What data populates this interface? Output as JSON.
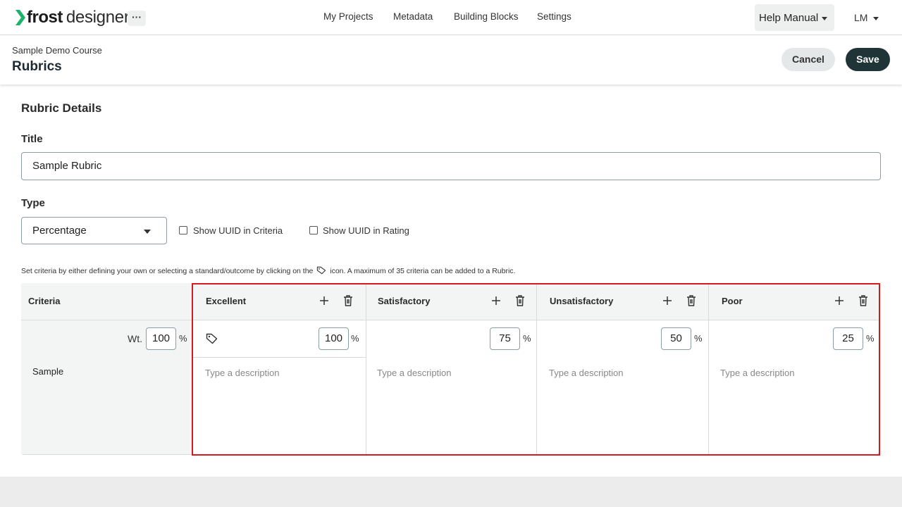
{
  "app": {
    "logo_bold": "frost",
    "logo_light": "designer",
    "more_label": "···"
  },
  "nav": {
    "links": [
      "My Projects",
      "Metadata",
      "Building Blocks",
      "Settings"
    ],
    "help_label": "Help Manual",
    "user_initials": "LM"
  },
  "header": {
    "breadcrumb": "Sample Demo Course",
    "title": "Rubrics",
    "cancel_label": "Cancel",
    "save_label": "Save"
  },
  "form": {
    "section_title": "Rubric Details",
    "title_label": "Title",
    "title_value": "Sample Rubric",
    "type_label": "Type",
    "type_value": "Percentage",
    "show_uuid_criteria_label": "Show UUID in Criteria",
    "show_uuid_criteria_checked": false,
    "show_uuid_rating_label": "Show UUID in Rating",
    "show_uuid_rating_checked": false,
    "hint_before": "Set criteria by either defining your own or selecting a standard/outcome by clicking on the",
    "hint_after": "icon. A maximum of 35 criteria can be added to a Rubric."
  },
  "rubric": {
    "criteria_header": "Criteria",
    "levels": [
      {
        "name": "Excellent",
        "value": "100",
        "unit": "%",
        "placeholder": "Type a description"
      },
      {
        "name": "Satisfactory",
        "value": "75",
        "unit": "%",
        "placeholder": "Type a description"
      },
      {
        "name": "Unsatisfactory",
        "value": "50",
        "unit": "%",
        "placeholder": "Type a description"
      },
      {
        "name": "Poor",
        "value": "25",
        "unit": "%",
        "placeholder": "Type a description"
      }
    ],
    "criterion": {
      "name": "Sample",
      "weight_label": "Wt.",
      "weight_value": "100",
      "weight_unit": "%"
    }
  },
  "colors": {
    "save_bg": "#1f3436",
    "highlight_border": "#d71920",
    "logo_green": "#1db36b"
  }
}
